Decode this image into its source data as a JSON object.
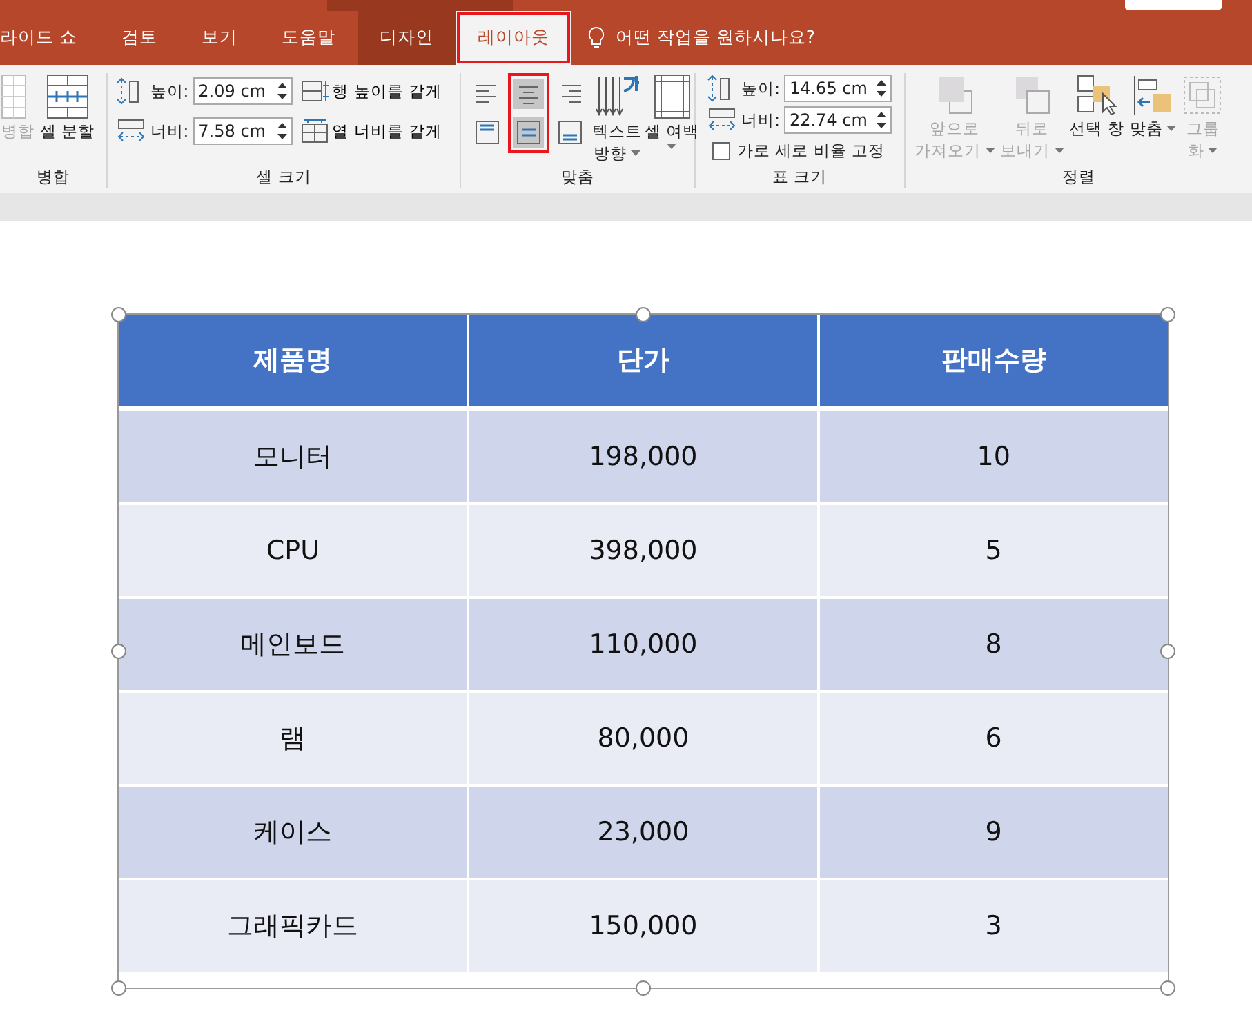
{
  "tabs": [
    {
      "label": "라이드 쇼",
      "selected": false,
      "contextual": false,
      "highlighted": false
    },
    {
      "label": "검토",
      "selected": false,
      "contextual": false,
      "highlighted": false
    },
    {
      "label": "보기",
      "selected": false,
      "contextual": false,
      "highlighted": false
    },
    {
      "label": "도움말",
      "selected": false,
      "contextual": false,
      "highlighted": false
    },
    {
      "label": "디자인",
      "selected": false,
      "contextual": true,
      "highlighted": false
    },
    {
      "label": "레이아웃",
      "selected": true,
      "contextual": true,
      "highlighted": true
    }
  ],
  "tell_me": "어떤 작업을 원하시나요?",
  "merge_group": {
    "label": "병합",
    "buttons": [
      {
        "kind": "merge",
        "label": "병합",
        "disabled": true
      },
      {
        "kind": "split",
        "label": "셀 분할",
        "disabled": false
      }
    ]
  },
  "cell_size": {
    "label": "셀 크기",
    "height_label": "높이:",
    "height": "2.09 cm",
    "width_label": "너비:",
    "width": "7.58 cm",
    "distribute": [
      {
        "kind": "rows",
        "label": "행 높이를 같게"
      },
      {
        "kind": "columns",
        "label": "열 너비를 같게"
      }
    ]
  },
  "alignment": {
    "label": "맞춤",
    "columns": [
      {
        "highlighted": false,
        "buttons": [
          {
            "kind": "left",
            "selected": false
          },
          {
            "kind": "top",
            "selected": false
          }
        ]
      },
      {
        "highlighted": true,
        "buttons": [
          {
            "kind": "center",
            "selected": true
          },
          {
            "kind": "middle",
            "selected": true
          }
        ]
      },
      {
        "highlighted": false,
        "buttons": [
          {
            "kind": "right",
            "selected": false
          },
          {
            "kind": "bottom",
            "selected": false
          }
        ]
      }
    ],
    "text_direction": [
      "텍스트",
      "방향"
    ],
    "margins": [
      "셀 여백"
    ]
  },
  "table_size": {
    "label": "표 크기",
    "height_label": "높이:",
    "height": "14.65 cm",
    "width_label": "너비:",
    "width": "22.74 cm",
    "lock_label": "가로 세로 비율 고정",
    "lock_checked": false
  },
  "arrange": {
    "label": "정렬",
    "buttons": [
      {
        "kind": "forward",
        "lines": [
          "앞으로",
          "가져오기"
        ],
        "disabled": true,
        "dropdown": true
      },
      {
        "kind": "backward",
        "lines": [
          "뒤로",
          "보내기"
        ],
        "disabled": true,
        "dropdown": true
      },
      {
        "kind": "pane",
        "lines": [
          "선택 창"
        ],
        "disabled": false,
        "dropdown": false
      },
      {
        "kind": "align",
        "lines": [
          "맞춤"
        ],
        "disabled": false,
        "dropdown": true
      },
      {
        "kind": "group",
        "lines": [
          "그룹",
          "화"
        ],
        "disabled": true,
        "dropdown": true
      }
    ]
  },
  "table": {
    "columns": [
      "제품명",
      "단가",
      "판매수량"
    ],
    "rows": [
      [
        "모니터",
        "198,000",
        "10"
      ],
      [
        "CPU",
        "398,000",
        "5"
      ],
      [
        "메인보드",
        "110,000",
        "8"
      ],
      [
        "램",
        "80,000",
        "6"
      ],
      [
        "케이스",
        "23,000",
        "9"
      ],
      [
        "그래픽카드",
        "150,000",
        "3"
      ]
    ]
  }
}
